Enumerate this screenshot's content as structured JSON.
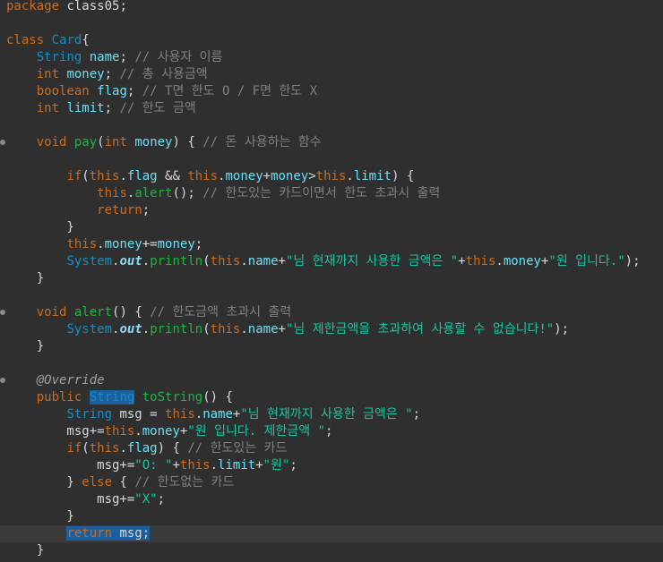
{
  "editor": {
    "language": "java",
    "current_line_index": 31,
    "colors": {
      "background": "#2f2f2f",
      "current_line": "#3a3a3a",
      "keyword": "#cc6c1d",
      "type": "#1290c3",
      "field": "#66e1f8",
      "method": "#1eb540",
      "comment": "#808080",
      "string": "#17c6a3",
      "text": "#d9d9d9",
      "selection": "#1b5fa0"
    },
    "lines": [
      {
        "marker": false,
        "tokens": [
          {
            "c": "kw",
            "t": "package"
          },
          {
            "c": "pl",
            "t": " class05;"
          }
        ]
      },
      {
        "marker": false,
        "tokens": []
      },
      {
        "marker": false,
        "tokens": [
          {
            "c": "kw",
            "t": "class"
          },
          {
            "c": "pl",
            "t": " "
          },
          {
            "c": "type",
            "t": "Card"
          },
          {
            "c": "pl",
            "t": "{"
          }
        ]
      },
      {
        "marker": false,
        "tokens": [
          {
            "c": "pl",
            "t": "    "
          },
          {
            "c": "type",
            "t": "String"
          },
          {
            "c": "pl",
            "t": " "
          },
          {
            "c": "field",
            "t": "name"
          },
          {
            "c": "pl",
            "t": "; "
          },
          {
            "c": "comment",
            "t": "// 사용자 이름"
          }
        ]
      },
      {
        "marker": false,
        "tokens": [
          {
            "c": "pl",
            "t": "    "
          },
          {
            "c": "kw",
            "t": "int"
          },
          {
            "c": "pl",
            "t": " "
          },
          {
            "c": "field",
            "t": "money"
          },
          {
            "c": "pl",
            "t": "; "
          },
          {
            "c": "comment",
            "t": "// 총 사용금액"
          }
        ]
      },
      {
        "marker": false,
        "tokens": [
          {
            "c": "pl",
            "t": "    "
          },
          {
            "c": "kw",
            "t": "boolean"
          },
          {
            "c": "pl",
            "t": " "
          },
          {
            "c": "field",
            "t": "flag"
          },
          {
            "c": "pl",
            "t": "; "
          },
          {
            "c": "comment",
            "t": "// T면 한도 O / F면 한도 X"
          }
        ]
      },
      {
        "marker": false,
        "tokens": [
          {
            "c": "pl",
            "t": "    "
          },
          {
            "c": "kw",
            "t": "int"
          },
          {
            "c": "pl",
            "t": " "
          },
          {
            "c": "field",
            "t": "limit"
          },
          {
            "c": "pl",
            "t": "; "
          },
          {
            "c": "comment",
            "t": "// 한도 금액"
          }
        ]
      },
      {
        "marker": false,
        "tokens": []
      },
      {
        "marker": true,
        "tokens": [
          {
            "c": "pl",
            "t": "    "
          },
          {
            "c": "kw",
            "t": "void"
          },
          {
            "c": "pl",
            "t": " "
          },
          {
            "c": "method",
            "t": "pay"
          },
          {
            "c": "pl",
            "t": "("
          },
          {
            "c": "kw",
            "t": "int"
          },
          {
            "c": "pl",
            "t": " "
          },
          {
            "c": "field",
            "t": "money"
          },
          {
            "c": "pl",
            "t": ") { "
          },
          {
            "c": "comment",
            "t": "// 돈 사용하는 함수"
          }
        ]
      },
      {
        "marker": false,
        "tokens": []
      },
      {
        "marker": false,
        "tokens": [
          {
            "c": "pl",
            "t": "        "
          },
          {
            "c": "kw",
            "t": "if"
          },
          {
            "c": "pl",
            "t": "("
          },
          {
            "c": "kw",
            "t": "this"
          },
          {
            "c": "pl",
            "t": "."
          },
          {
            "c": "field",
            "t": "flag"
          },
          {
            "c": "pl",
            "t": " && "
          },
          {
            "c": "kw",
            "t": "this"
          },
          {
            "c": "pl",
            "t": "."
          },
          {
            "c": "field",
            "t": "money"
          },
          {
            "c": "pl",
            "t": "+"
          },
          {
            "c": "field",
            "t": "money"
          },
          {
            "c": "pl",
            "t": ">"
          },
          {
            "c": "kw",
            "t": "this"
          },
          {
            "c": "pl",
            "t": "."
          },
          {
            "c": "field",
            "t": "limit"
          },
          {
            "c": "pl",
            "t": ") {"
          }
        ]
      },
      {
        "marker": false,
        "tokens": [
          {
            "c": "pl",
            "t": "            "
          },
          {
            "c": "kw",
            "t": "this"
          },
          {
            "c": "pl",
            "t": "."
          },
          {
            "c": "method",
            "t": "alert"
          },
          {
            "c": "pl",
            "t": "(); "
          },
          {
            "c": "comment",
            "t": "// 한도있는 카드이면서 한도 초과시 출력"
          }
        ]
      },
      {
        "marker": false,
        "tokens": [
          {
            "c": "pl",
            "t": "            "
          },
          {
            "c": "kw",
            "t": "return"
          },
          {
            "c": "pl",
            "t": ";"
          }
        ]
      },
      {
        "marker": false,
        "tokens": [
          {
            "c": "pl",
            "t": "        }"
          }
        ]
      },
      {
        "marker": false,
        "tokens": [
          {
            "c": "pl",
            "t": "        "
          },
          {
            "c": "kw",
            "t": "this"
          },
          {
            "c": "pl",
            "t": "."
          },
          {
            "c": "field",
            "t": "money"
          },
          {
            "c": "pl",
            "t": "+="
          },
          {
            "c": "field",
            "t": "money"
          },
          {
            "c": "pl",
            "t": ";"
          }
        ]
      },
      {
        "marker": false,
        "tokens": [
          {
            "c": "pl",
            "t": "        "
          },
          {
            "c": "type",
            "t": "System"
          },
          {
            "c": "pl",
            "t": "."
          },
          {
            "c": "static-field",
            "t": "out"
          },
          {
            "c": "pl",
            "t": "."
          },
          {
            "c": "method",
            "t": "println"
          },
          {
            "c": "pl",
            "t": "("
          },
          {
            "c": "kw",
            "t": "this"
          },
          {
            "c": "pl",
            "t": "."
          },
          {
            "c": "field",
            "t": "name"
          },
          {
            "c": "pl",
            "t": "+"
          },
          {
            "c": "str",
            "t": "\"님 현재까지 사용한 금액은 \""
          },
          {
            "c": "pl",
            "t": "+"
          },
          {
            "c": "kw",
            "t": "this"
          },
          {
            "c": "pl",
            "t": "."
          },
          {
            "c": "field",
            "t": "money"
          },
          {
            "c": "pl",
            "t": "+"
          },
          {
            "c": "str",
            "t": "\"원 입니다.\""
          },
          {
            "c": "pl",
            "t": ");"
          }
        ]
      },
      {
        "marker": false,
        "tokens": [
          {
            "c": "pl",
            "t": "    }"
          }
        ]
      },
      {
        "marker": false,
        "tokens": []
      },
      {
        "marker": true,
        "tokens": [
          {
            "c": "pl",
            "t": "    "
          },
          {
            "c": "kw",
            "t": "void"
          },
          {
            "c": "pl",
            "t": " "
          },
          {
            "c": "method",
            "t": "alert"
          },
          {
            "c": "pl",
            "t": "() { "
          },
          {
            "c": "comment",
            "t": "// 한도금액 초과시 출력"
          }
        ]
      },
      {
        "marker": false,
        "tokens": [
          {
            "c": "pl",
            "t": "        "
          },
          {
            "c": "type",
            "t": "System"
          },
          {
            "c": "pl",
            "t": "."
          },
          {
            "c": "static-field",
            "t": "out"
          },
          {
            "c": "pl",
            "t": "."
          },
          {
            "c": "method",
            "t": "println"
          },
          {
            "c": "pl",
            "t": "("
          },
          {
            "c": "kw",
            "t": "this"
          },
          {
            "c": "pl",
            "t": "."
          },
          {
            "c": "field",
            "t": "name"
          },
          {
            "c": "pl",
            "t": "+"
          },
          {
            "c": "str",
            "t": "\"님 제한금액을 초과하여 사용할 수 없습니다!\""
          },
          {
            "c": "pl",
            "t": ");"
          }
        ]
      },
      {
        "marker": false,
        "tokens": [
          {
            "c": "pl",
            "t": "    }"
          }
        ]
      },
      {
        "marker": false,
        "tokens": []
      },
      {
        "marker": true,
        "tokens": [
          {
            "c": "pl",
            "t": "    "
          },
          {
            "c": "annotation",
            "t": "@Override"
          }
        ]
      },
      {
        "marker": false,
        "tokens": [
          {
            "c": "pl",
            "t": "    "
          },
          {
            "c": "kw",
            "t": "public"
          },
          {
            "c": "pl",
            "t": " "
          },
          {
            "c": "type sel",
            "t": "String"
          },
          {
            "c": "pl",
            "t": " "
          },
          {
            "c": "method",
            "t": "toString"
          },
          {
            "c": "pl",
            "t": "() {"
          }
        ]
      },
      {
        "marker": false,
        "tokens": [
          {
            "c": "pl",
            "t": "        "
          },
          {
            "c": "type",
            "t": "String"
          },
          {
            "c": "pl",
            "t": " msg = "
          },
          {
            "c": "kw",
            "t": "this"
          },
          {
            "c": "pl",
            "t": "."
          },
          {
            "c": "field",
            "t": "name"
          },
          {
            "c": "pl",
            "t": "+"
          },
          {
            "c": "str",
            "t": "\"님 현재까지 사용한 금액은 \""
          },
          {
            "c": "pl",
            "t": ";"
          }
        ]
      },
      {
        "marker": false,
        "tokens": [
          {
            "c": "pl",
            "t": "        msg+="
          },
          {
            "c": "kw",
            "t": "this"
          },
          {
            "c": "pl",
            "t": "."
          },
          {
            "c": "field",
            "t": "money"
          },
          {
            "c": "pl",
            "t": "+"
          },
          {
            "c": "str",
            "t": "\"원 입니다. 제한금액 \""
          },
          {
            "c": "pl",
            "t": ";"
          }
        ]
      },
      {
        "marker": false,
        "tokens": [
          {
            "c": "pl",
            "t": "        "
          },
          {
            "c": "kw",
            "t": "if"
          },
          {
            "c": "pl",
            "t": "("
          },
          {
            "c": "kw",
            "t": "this"
          },
          {
            "c": "pl",
            "t": "."
          },
          {
            "c": "field",
            "t": "flag"
          },
          {
            "c": "pl",
            "t": ") { "
          },
          {
            "c": "comment",
            "t": "// 한도있는 카드"
          }
        ]
      },
      {
        "marker": false,
        "tokens": [
          {
            "c": "pl",
            "t": "            msg+="
          },
          {
            "c": "str",
            "t": "\"O: \""
          },
          {
            "c": "pl",
            "t": "+"
          },
          {
            "c": "kw",
            "t": "this"
          },
          {
            "c": "pl",
            "t": "."
          },
          {
            "c": "field",
            "t": "limit"
          },
          {
            "c": "pl",
            "t": "+"
          },
          {
            "c": "str",
            "t": "\"원\""
          },
          {
            "c": "pl",
            "t": ";"
          }
        ]
      },
      {
        "marker": false,
        "tokens": [
          {
            "c": "pl",
            "t": "        } "
          },
          {
            "c": "kw",
            "t": "else"
          },
          {
            "c": "pl",
            "t": " { "
          },
          {
            "c": "comment",
            "t": "// 한도없는 카드"
          }
        ]
      },
      {
        "marker": false,
        "tokens": [
          {
            "c": "pl",
            "t": "            msg+="
          },
          {
            "c": "str",
            "t": "\"X\""
          },
          {
            "c": "pl",
            "t": ";"
          }
        ]
      },
      {
        "marker": false,
        "tokens": [
          {
            "c": "pl",
            "t": "        }"
          }
        ]
      },
      {
        "marker": false,
        "tokens": [
          {
            "c": "pl",
            "t": "        "
          },
          {
            "c": "kw sel",
            "t": "return"
          },
          {
            "c": "pl sel",
            "t": " msg;"
          }
        ]
      },
      {
        "marker": false,
        "tokens": [
          {
            "c": "pl",
            "t": "    }"
          }
        ]
      }
    ]
  }
}
